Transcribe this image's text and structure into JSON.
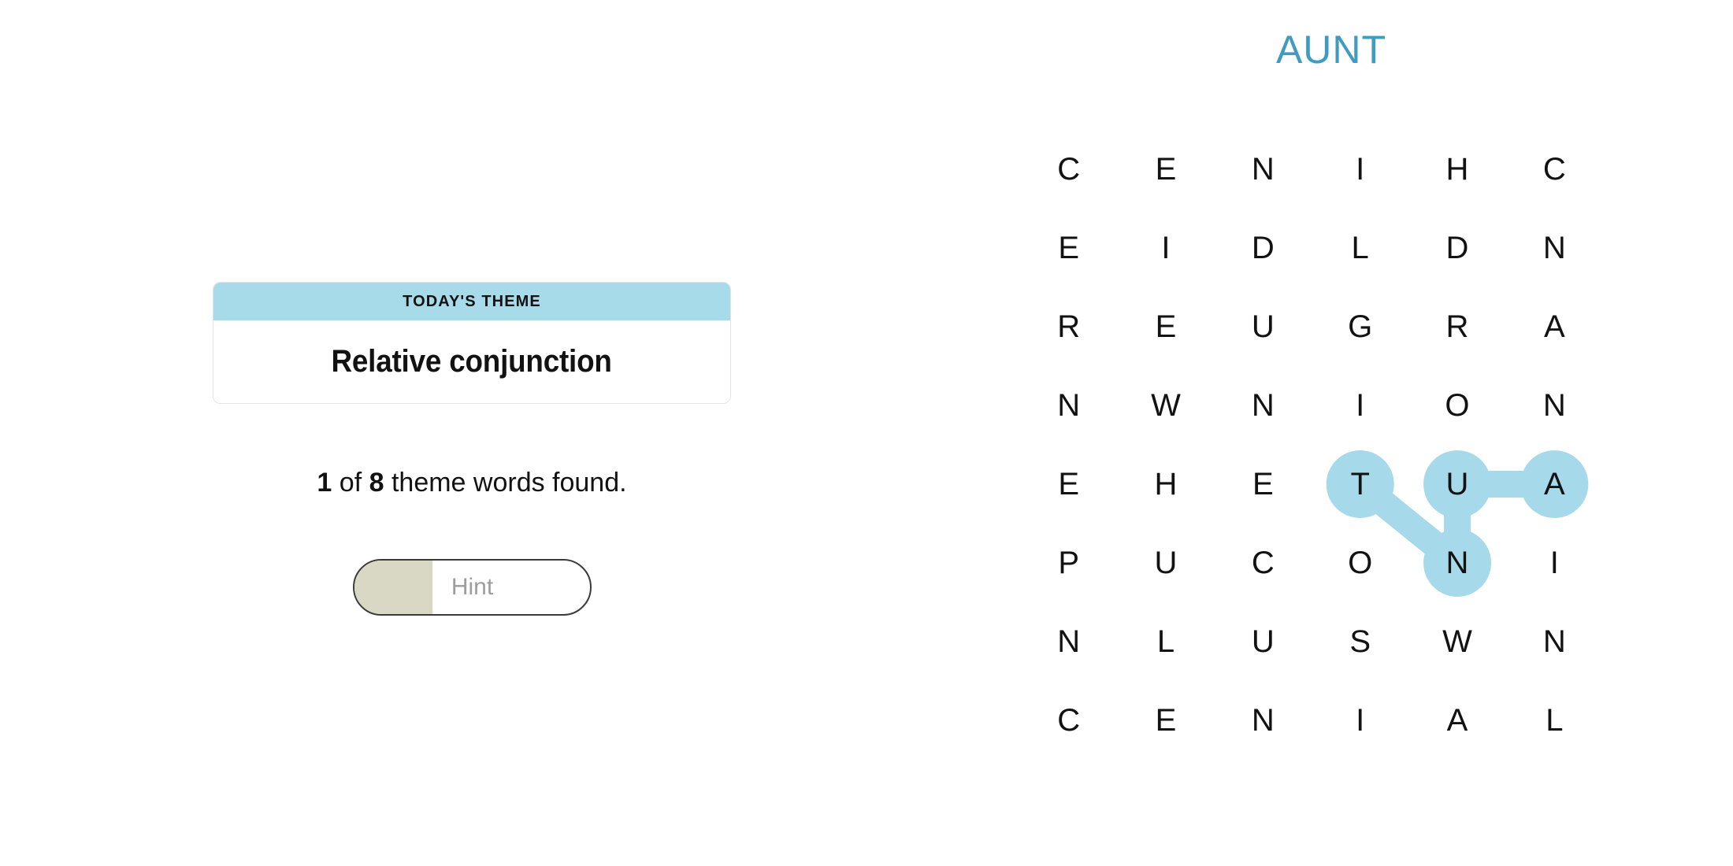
{
  "found_word_title": "AUNT",
  "theme_card": {
    "header_label": "TODAY'S THEME",
    "theme": "Relative conjunction"
  },
  "progress": {
    "found_count": "1",
    "between_text": " of ",
    "total_count": "8",
    "suffix_text": " theme words found."
  },
  "hint_button": {
    "label": "Hint",
    "fill_percent": 33
  },
  "colors": {
    "accent_blue": "#3f9cc0",
    "highlight_blue": "#a6d9ea",
    "theme_header_blue": "#a8dbe9",
    "hint_fill": "#d9d8c5",
    "hint_label": "#9d9d9d",
    "letter": "#121212"
  },
  "grid": {
    "rows": 8,
    "cols": 6,
    "letters": [
      [
        "C",
        "E",
        "N",
        "I",
        "H",
        "C"
      ],
      [
        "E",
        "I",
        "D",
        "L",
        "D",
        "N"
      ],
      [
        "R",
        "E",
        "U",
        "G",
        "R",
        "A"
      ],
      [
        "N",
        "W",
        "N",
        "I",
        "O",
        "N"
      ],
      [
        "E",
        "H",
        "E",
        "T",
        "U",
        "A"
      ],
      [
        "P",
        "U",
        "C",
        "O",
        "N",
        "I"
      ],
      [
        "N",
        "L",
        "U",
        "S",
        "W",
        "N"
      ],
      [
        "C",
        "E",
        "N",
        "I",
        "A",
        "L"
      ]
    ],
    "highlighted_path": {
      "word": "AUNT",
      "cells": [
        {
          "row": 4,
          "col": 5,
          "letter": "A"
        },
        {
          "row": 4,
          "col": 4,
          "letter": "U"
        },
        {
          "row": 5,
          "col": 4,
          "letter": "N"
        },
        {
          "row": 4,
          "col": 3,
          "letter": "T"
        }
      ]
    }
  }
}
